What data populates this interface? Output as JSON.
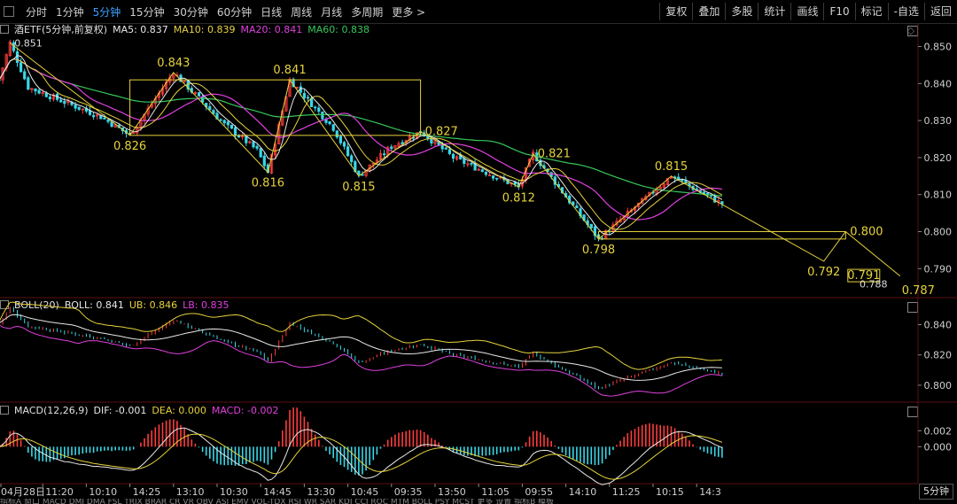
{
  "toolbar": {
    "timeframes": [
      {
        "label": "分时",
        "active": false
      },
      {
        "label": "1分钟",
        "active": false
      },
      {
        "label": "5分钟",
        "active": true
      },
      {
        "label": "15分钟",
        "active": false
      },
      {
        "label": "30分钟",
        "active": false
      },
      {
        "label": "60分钟",
        "active": false
      },
      {
        "label": "日线",
        "active": false
      },
      {
        "label": "周线",
        "active": false
      },
      {
        "label": "月线",
        "active": false
      },
      {
        "label": "多周期",
        "active": false
      },
      {
        "label": "更多 >",
        "active": false
      }
    ],
    "right_buttons": [
      "复权",
      "叠加",
      "多股",
      "统计",
      "画线",
      "F10",
      "标记",
      "-自选",
      "返回"
    ]
  },
  "legends": {
    "main": {
      "name": "酒ETF(5分钟,前复权)",
      "items": [
        {
          "text": "MA5: 0.837",
          "color": "#e8e8e8"
        },
        {
          "text": "MA10: 0.839",
          "color": "#e6d23c"
        },
        {
          "text": "MA20: 0.841",
          "color": "#e040e0"
        },
        {
          "text": "MA60: 0.838",
          "color": "#36c85a"
        }
      ]
    },
    "boll": {
      "name": "BOLL(20)",
      "items": [
        {
          "text": "BOLL: 0.841",
          "color": "#e8e8e8"
        },
        {
          "text": "UB: 0.846",
          "color": "#e6d23c"
        },
        {
          "text": "LB: 0.835",
          "color": "#e040e0"
        }
      ]
    },
    "macd": {
      "name": "MACD(12,26,9)",
      "items": [
        {
          "text": "DIF: -0.001",
          "color": "#e8e8e8"
        },
        {
          "text": "DEA: 0.000",
          "color": "#e6d23c"
        },
        {
          "text": "MACD: -0.002",
          "color": "#e040e0"
        }
      ]
    }
  },
  "timeframe_mark": "5分钟",
  "bottom_strip": "指标A 窗口 MACD DMI DMA FSL TRIX BRAR CR VR OBV ASI EMV VOL-TDX RSI WR SAR KDJ CCI ROC MTM BOLL PSY MCST 更多 设置 指标B 模板",
  "colors": {
    "up": "#ff3c3c",
    "down": "#3ad7e8",
    "ma5": "#e8e8e8",
    "ma10": "#e6d23c",
    "ma20": "#e040e0",
    "ma60": "#36c85a",
    "overlay": "#e6d23c",
    "axis": "#888888"
  },
  "chart_data": [
    {
      "type": "candlestick",
      "title": "酒ETF(5分钟,前复权)",
      "ylim": [
        0.786,
        0.853
      ],
      "yticks": [
        "0.850",
        "0.840",
        "0.830",
        "0.820",
        "0.810",
        "0.800",
        "0.790"
      ],
      "xticks": [
        "04月28日",
        "11:20",
        "10:10",
        "14:25",
        "13:10",
        "10:30",
        "14:45",
        "13:30",
        "10:45",
        "09:35",
        "13:50",
        "11:05",
        "09:55",
        "14:10",
        "11:25",
        "10:15",
        "14:3"
      ],
      "bars_per_xtick": 12,
      "n_bars": 200,
      "anchors": [
        {
          "x": 0,
          "y": 0.841
        },
        {
          "x": 3,
          "y": 0.851
        },
        {
          "x": 8,
          "y": 0.839
        },
        {
          "x": 28,
          "y": 0.831
        },
        {
          "x": 36,
          "y": 0.826
        },
        {
          "x": 48,
          "y": 0.843
        },
        {
          "x": 62,
          "y": 0.829
        },
        {
          "x": 71,
          "y": 0.822
        },
        {
          "x": 74,
          "y": 0.816
        },
        {
          "x": 80,
          "y": 0.841
        },
        {
          "x": 92,
          "y": 0.828
        },
        {
          "x": 99,
          "y": 0.815
        },
        {
          "x": 108,
          "y": 0.823
        },
        {
          "x": 116,
          "y": 0.827
        },
        {
          "x": 125,
          "y": 0.82
        },
        {
          "x": 143,
          "y": 0.812
        },
        {
          "x": 147,
          "y": 0.821
        },
        {
          "x": 165,
          "y": 0.798
        },
        {
          "x": 185,
          "y": 0.815
        },
        {
          "x": 198,
          "y": 0.808
        },
        {
          "x": 213,
          "y": 0.802
        },
        {
          "x": 227,
          "y": 0.792
        },
        {
          "x": 233,
          "y": 0.8
        },
        {
          "x": 238,
          "y": 0.791
        },
        {
          "x": 245,
          "y": 0.788
        },
        {
          "x": 253,
          "y": 0.79
        }
      ],
      "peak_labels": [
        {
          "x": 3,
          "y": 0.851,
          "text": "0.851",
          "pos": "right"
        },
        {
          "x": 48,
          "y": 0.843,
          "text": "0.843",
          "pos": "above"
        },
        {
          "x": 36,
          "y": 0.826,
          "text": "0.826",
          "pos": "below"
        },
        {
          "x": 80,
          "y": 0.841,
          "text": "0.841",
          "pos": "above"
        },
        {
          "x": 74,
          "y": 0.816,
          "text": "0.816",
          "pos": "below"
        },
        {
          "x": 99,
          "y": 0.815,
          "text": "0.815",
          "pos": "below"
        },
        {
          "x": 116,
          "y": 0.827,
          "text": "0.827",
          "pos": "right"
        },
        {
          "x": 143,
          "y": 0.812,
          "text": "0.812",
          "pos": "below"
        },
        {
          "x": 147,
          "y": 0.821,
          "text": "0.821",
          "pos": "right"
        },
        {
          "x": 165,
          "y": 0.798,
          "text": "0.798",
          "pos": "below"
        },
        {
          "x": 185,
          "y": 0.815,
          "text": "0.815",
          "pos": "above"
        },
        {
          "x": 227,
          "y": 0.792,
          "text": "0.792",
          "pos": "below"
        },
        {
          "x": 233,
          "y": 0.8,
          "text": "0.800",
          "pos": "right"
        },
        {
          "x": 238,
          "y": 0.791,
          "text": "0.791",
          "pos": "box"
        },
        {
          "x": 245,
          "y": 0.788,
          "text": "0.788",
          "pos": "belowleft"
        },
        {
          "x": 253,
          "y": 0.787,
          "text": "0.787",
          "pos": "below"
        }
      ],
      "overlay": {
        "zigzag": [
          [
            3,
            0.851
          ],
          [
            36,
            0.826
          ],
          [
            48,
            0.843
          ],
          [
            74,
            0.816
          ],
          [
            80,
            0.841
          ],
          [
            99,
            0.815
          ],
          [
            116,
            0.827
          ],
          [
            143,
            0.812
          ],
          [
            147,
            0.821
          ],
          [
            165,
            0.798
          ],
          [
            185,
            0.815
          ],
          [
            227,
            0.792
          ],
          [
            233,
            0.8
          ],
          [
            248,
            0.788
          ]
        ],
        "boxes": [
          {
            "x0": 36,
            "x1": 116,
            "y0": 0.826,
            "y1": 0.841
          },
          {
            "x0": 165,
            "x1": 233,
            "y0": 0.798,
            "y1": 0.8
          }
        ]
      }
    },
    {
      "type": "line",
      "title": "BOLL(20)",
      "ylim": [
        0.79,
        0.852
      ],
      "yticks": [
        "0.840",
        "0.820",
        "0.800"
      ]
    },
    {
      "type": "bar",
      "title": "MACD(12,26,9)",
      "ylim": [
        -0.0045,
        0.0038
      ],
      "yticks": [
        "0.002",
        "0.000"
      ]
    }
  ]
}
